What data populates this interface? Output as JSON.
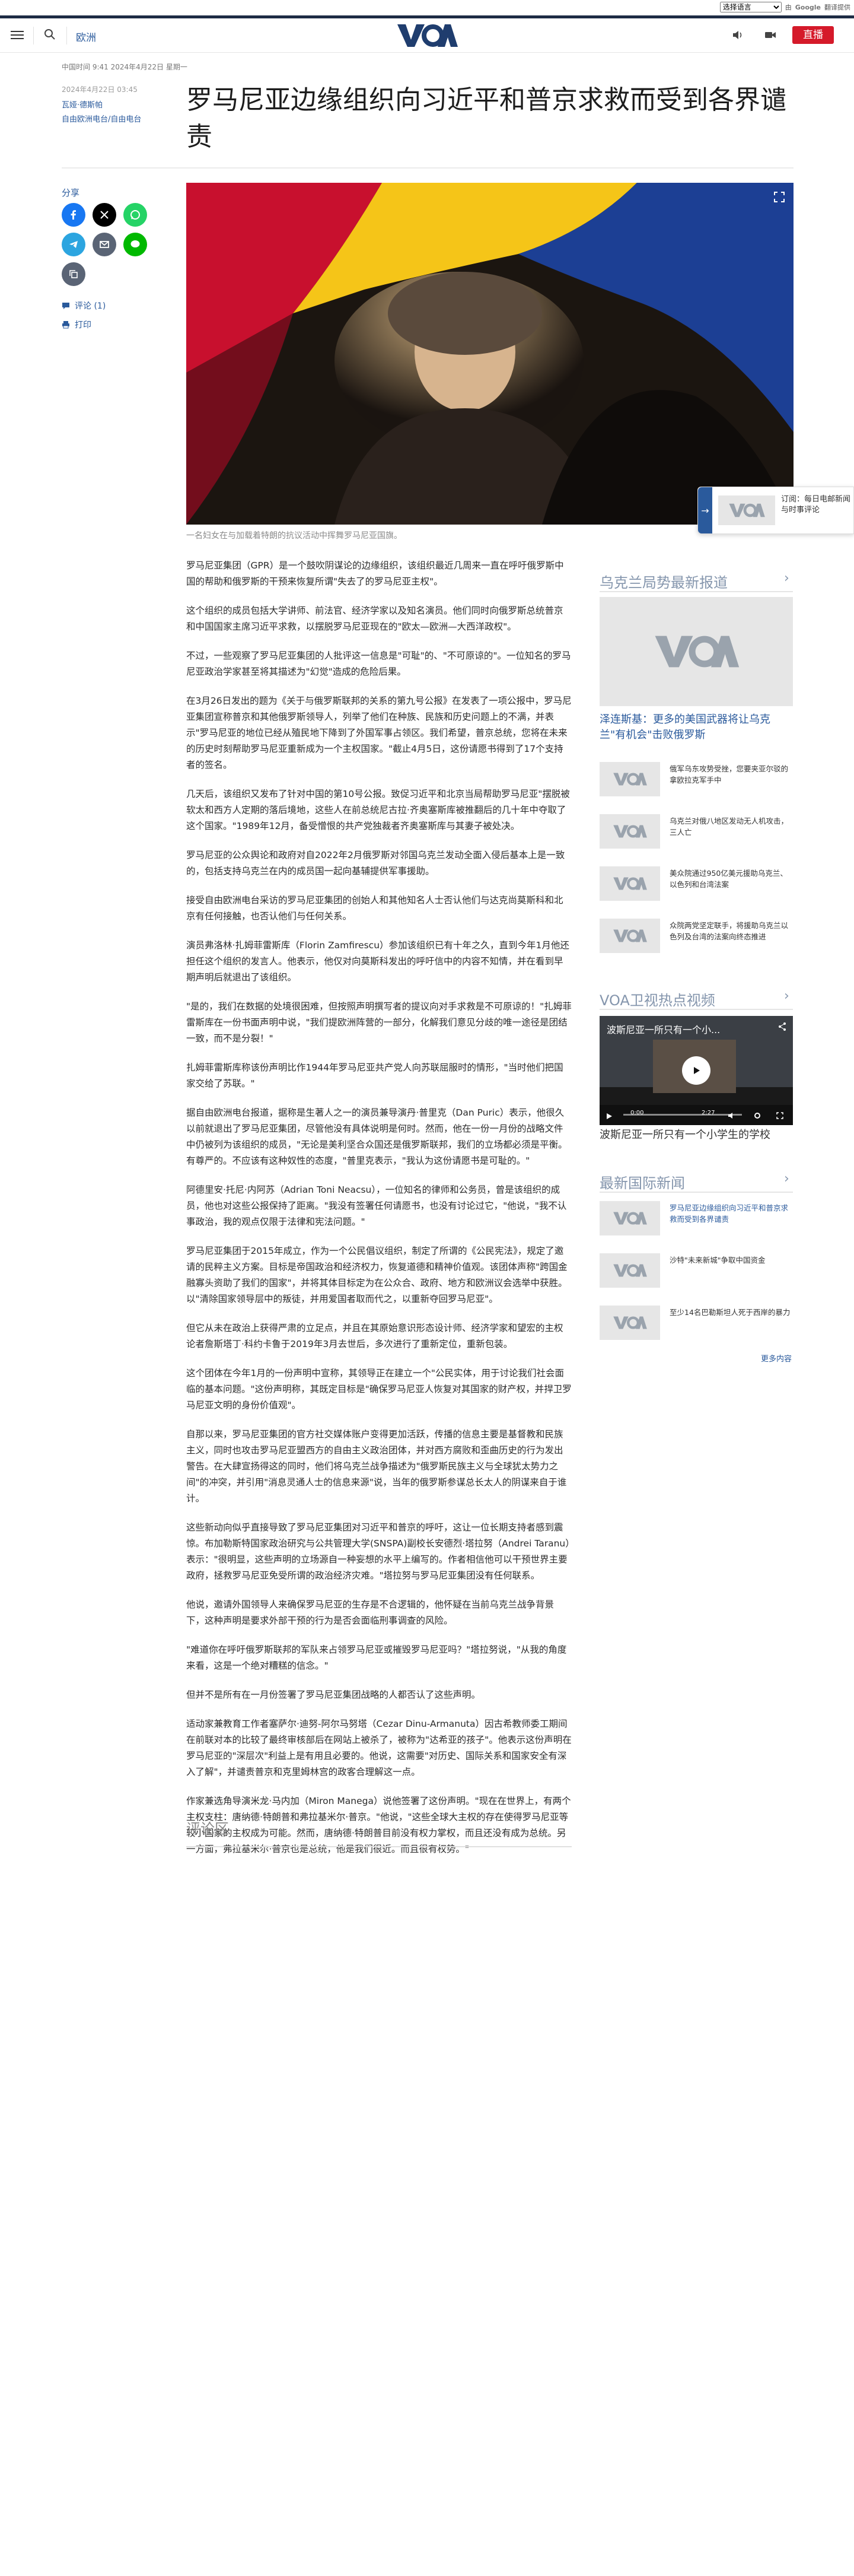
{
  "translate": {
    "select_label": "选择语言",
    "powered_prefix": "由",
    "google": "Google",
    "translate_word": "翻译提供"
  },
  "header": {
    "section": "欧洲",
    "logo_text": "VOA",
    "live_label": "直播"
  },
  "article": {
    "meta": "中国时间 9:41 2024年4月22日 星期一",
    "date": "2024年4月22日 03:45",
    "authors": [
      "瓦娅·德斯帕",
      "自由欧洲电台/自由电台"
    ],
    "title": "罗马尼亚边缘组织向习近平和普京求救而受到各界谴责",
    "caption": "一名妇女在与加载着特朗的抗议活动中挥舞罗马尼亚国旗。",
    "paragraphs": [
      "罗马尼亚集团（GPR）是一个鼓吹阴谋论的边缘组织，该组织最近几周来一直在呼吁俄罗斯中国的帮助和俄罗斯的干预来恢复所谓\"失去了的罗马尼亚主权\"。",
      "这个组织的成员包括大学讲师、前法官、经济学家以及知名演员。他们同时向俄罗斯总统普京和中国国家主席习近平求救，以摆脱罗马尼亚现在的\"欧太—欧洲—大西洋政权\"。",
      "不过，一些观察了罗马尼亚集团的人批评这一信息是\"可耻\"的、\"不可原谅的\"。一位知名的罗马尼亚政治学家甚至将其描述为\"幻觉\"造成的危险后果。",
      "在3月26日发出的题为《关于与俄罗斯联邦的关系的第九号公报》在发表了一项公报中，罗马尼亚集团宣称普京和其他俄罗斯领导人，列举了他们在种族、民族和历史问题上的不满，并表示\"罗马尼亚的地位已经从殖民地下降到了外国军事占领区。我们希望，普京总统，您将在未来的历史时刻帮助罗马尼亚重新成为一个主权国家。\"截止4月5日，这份请愿书得到了17个支持者的签名。",
      "几天后，该组织又发布了针对中国的第10号公报。致促习近平和北京当局帮助罗马尼亚\"摆脱被软太和西方人定期的落后境地，这些人在前总统尼古拉·齐奥塞斯库被推翻后的几十年中夺取了这个国家。\"1989年12月，备受憎恨的共产党独裁者齐奥塞斯库与其妻子被处决。",
      "罗马尼亚的公众舆论和政府对自2022年2月俄罗斯对邻国乌克兰发动全面入侵后基本上是一致的，包括支持乌克兰在内的成员国一起向基辅提供军事援助。",
      "接受自由欧洲电台采访的罗马尼亚集团的创始人和其他知名人士否认他们与达克尚莫斯科和北京有任何接触，也否认他们与任何关系。",
      "演员弗洛林·扎姆菲雷斯库（Florin Zamfirescu）参加该组织已有十年之久，直到今年1月他还担任这个组织的发言人。他表示，他仅对向莫斯科发出的呼吁信中的内容不知情，并在看到早期声明后就退出了该组织。",
      "\"是的，我们在数据的处境很困难，但按照声明撰写者的提议向对手求救是不可原谅的！\"扎姆菲雷斯库在一份书面声明中说，\"我们提欧洲阵营的一部分，化解我们意见分歧的唯一途径是团结一致，而不是分裂！\"",
      "扎姆菲雷斯库称该份声明比作1944年罗马尼亚共产党人向苏联屈服时的情形，\"当时他们把国家交给了苏联。\"",
      "据自由欧洲电台报道，据称是生著人之一的演员兼导演丹·普里克（Dan Puric）表示，他很久以前就退出了罗马尼亚集团，尽管他没有具体说明是何时。然而，他在一份一月份的战略文件中仍被列为该组织的成员，\"无论是美利坚合众国还是俄罗斯联邦，我们的立场都必须是平衡。有尊严的。不应该有这种奴性的态度，\"普里克表示，\"我认为这份请愿书是可耻的。\"",
      "阿德里安·托尼·内阿苏（Adrian Toni Neacsu），一位知名的律师和公务员，曾是该组织的成员，他也对这些公报保持了距离。\"我没有签署任何请愿书，也没有讨论过它，\"他说，\"我不认事政治，我的观点仅限于法律和宪法问题。\"",
      "罗马尼亚集团于2015年成立，作为一个公民倡议组织，制定了所谓的《公民宪法》，规定了邀请的民粹主义方案。目标是帝国政治和经济权力，恢复道德和精神价值观。该团体声称\"跨国金融寡头资助了我们的国家\"，并将其体目标定为在公众合、政府、地方和欧洲议会选举中获胜。以\"清除国家领导层中的叛徒，并用爱国者取而代之，以重新夺回罗马尼亚\"。",
      "但它从未在政治上获得严肃的立足点，并且在其原始意识形态设计师、经济学家和望宏的主权论者詹斯塔丁·科约卡鲁于2019年3月去世后，多次进行了重新定位，重新包装。",
      "这个团体在今年1月的一份声明中宣称，其领导正在建立一个\"公民实体，用于讨论我们社会面临的基本问题。\"这份声明称，其既定目标是\"确保罗马尼亚人恢复对其国家的财产权，并捍卫罗马尼亚文明的身份价值观\"。",
      "自那以来，罗马尼亚集团的官方社交媒体账户变得更加活跃，传播的信息主要是基督教和民族主义，同时也攻击罗马尼亚盟西方的自由主义政治团体，并对西方腐败和歪曲历史的行为发出警告。在大肆宣扬得这的同时，他们将乌克兰战争描述为\"俄罗斯民族主义与全球犹太势力之间\"的冲突，并引用\"消息灵通人士的信息来源\"说，当年的俄罗斯参谋总长太人的阴谋来自于谁计。",
      "这些新动向似乎直接导致了罗马尼亚集团对习近平和普京的呼吁，这让一位长期支持者感到震惊。布加勒斯特国家政治研究与公共管理大学(SNSPA)副校长安德烈·塔拉努（Andrei Taranu）表示：\"很明显，这些声明的立场源自一种妄想的水平上编写的。作者相信他可以干预世界主要政府，拯救罗马尼亚免受所谓的政治经济灾难。\"塔拉努与罗马尼亚集团没有任何联系。",
      "他说，邀请外国领导人来确保罗马尼亚的生存是不合逻辑的，他怀疑在当前乌克兰战争背景下，这种声明是要求外部干预的行为是否会面临刑事调查的风险。",
      "\"难道你在呼吁俄罗斯联邦的军队来占领罗马尼亚或摧毁罗马尼亚吗？\"塔拉努说，\"从我的角度来看，这是一个绝对糟糕的信念。\"",
      "但并不是所有在一月份签署了罗马尼亚集团战略的人都否认了这些声明。",
      "适动家兼教育工作者塞萨尔·迪努-阿尔马努塔（Cezar Dinu-Armanuta）因古希教师委工期间在前联对本的比较了最终审核部后在网站上被杀了，被称为\"达希亚的孩子\"。他表示这份声明在罗马尼亚的\"深层次\"利益上是有用且必要的。他说，这需要\"对历史、国际关系和国家安全有深入了解\"，并谴责普京和克里姆林宫的政客合理解这一点。",
      "作家兼选角导演米龙·马内加（Miron Manega）说他签署了这份声明。\"现在在世界上，有两个主权支柱：唐纳德·特朗普和弗拉基米尔·普京。\"他说，\"这些全球大主权的存在使得罗马尼亚等较小国家的主权成为可能。然而，唐纳德·特朗普目前没有权力掌权，而且还没有成为总统。另一方面，弗拉基米尔·普京也是总统，他是我们很近。而且很有权势。\""
    ],
    "comments_title": "评论区"
  },
  "share": {
    "label": "分享",
    "comments_link": "评论 (1)",
    "print_link": "打印"
  },
  "sidebar": {
    "romania_head": "乌克兰局势最新报道",
    "feature_title": "泽连斯基：更多的美国武器将让乌克兰\"有机会\"击败俄罗斯",
    "romania_items": [
      "俄军乌东攻势受挫，您要夹亚尔驳的拿欧拉克军手中",
      "乌克兰对俄八地区发动无人机攻击，三人亡",
      "美众院通过950亿美元援助乌克兰、以色列和台湾法案",
      "众院两党坚定联手，将援助乌克兰以色列及台湾的法案向终态推进"
    ],
    "tv_head": "VOA卫视热点视频",
    "video_title": "波斯尼亚一所只有一个小...",
    "video_time": "0:00",
    "video_duration": "2:27",
    "video_caption": "波斯尼亚一所只有一个小学生的学校",
    "intl_head": "最新国际新闻",
    "intl_items": [
      "罗马尼亚边缘组织向习近平和普京求救而受到各界谴责",
      "沙特\"未来新城\"争取中国资金",
      "至少14名巴勒斯坦人死于西岸的暴力"
    ],
    "more_label": "更多内容"
  },
  "promo": {
    "text": "订阅：每日电邮新闻与时事评论"
  },
  "colors": {
    "brand_blue": "#2a5a9c",
    "live_red": "#d51a2a",
    "dark_bar": "#1e2c45"
  }
}
